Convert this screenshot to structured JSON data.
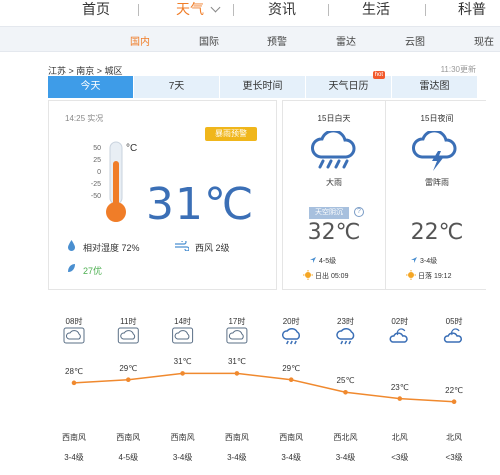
{
  "topnav": {
    "items": [
      "首页",
      "天气",
      "资讯",
      "生活",
      "科普"
    ],
    "active": "天气"
  },
  "subnav": {
    "items": [
      "国内",
      "国际",
      "预警",
      "雷达",
      "云图",
      "现在"
    ],
    "active": "国内"
  },
  "breadcrumb": "江苏 > 南京 > 城区",
  "updated": "11:30更新",
  "tabs": [
    "今天",
    "7天",
    "更长时间",
    "天气日历",
    "雷达图"
  ],
  "tabs_hot_badge": "hot",
  "today": {
    "now_label": "14:25 实况",
    "alert": "暴雨预警",
    "unit_c": "°C",
    "scale": [
      "50",
      "25",
      "0",
      "-25",
      "-50"
    ],
    "temperature": "31℃",
    "humidity": "相对湿度  72%",
    "wind": "西风  2级",
    "aqi": "27优",
    "thermometer_fill": 0.55
  },
  "day": {
    "title": "15日白天",
    "condition": "大雨",
    "aq_label": "天空阴沉",
    "temp": "32℃",
    "wind": "4-5级",
    "sun": "日出 05:09"
  },
  "night": {
    "title": "15日夜间",
    "condition": "雷阵雨",
    "temp": "22℃",
    "wind": "3-4级",
    "sun": "日落 19:12"
  },
  "hourly": {
    "hours": [
      "08时",
      "11时",
      "14时",
      "17时",
      "20时",
      "23时",
      "02时",
      "05时"
    ],
    "icons": [
      "overcast",
      "overcast",
      "overcast",
      "overcast",
      "rain",
      "rain",
      "partly-cloudy",
      "partly-cloudy"
    ],
    "temps": [
      28,
      29,
      31,
      31,
      29,
      25,
      23,
      22
    ],
    "temp_labels": [
      "28℃",
      "29℃",
      "31℃",
      "31℃",
      "29℃",
      "25℃",
      "23℃",
      "22℃"
    ],
    "wind_dirs": [
      "西南风",
      "西南风",
      "西南风",
      "西南风",
      "西南风",
      "西北风",
      "北风",
      "北风"
    ],
    "wind_levels": [
      "3-4级",
      "4-5级",
      "3-4级",
      "3-4级",
      "3-4级",
      "3-4级",
      "<3级",
      "<3级"
    ]
  },
  "colors": {
    "accent": "#f07d28",
    "tab_active": "#3e9ce8",
    "temp_blue": "#3b6fb6",
    "alert": "#f0b61b",
    "line": "#f0892e"
  }
}
